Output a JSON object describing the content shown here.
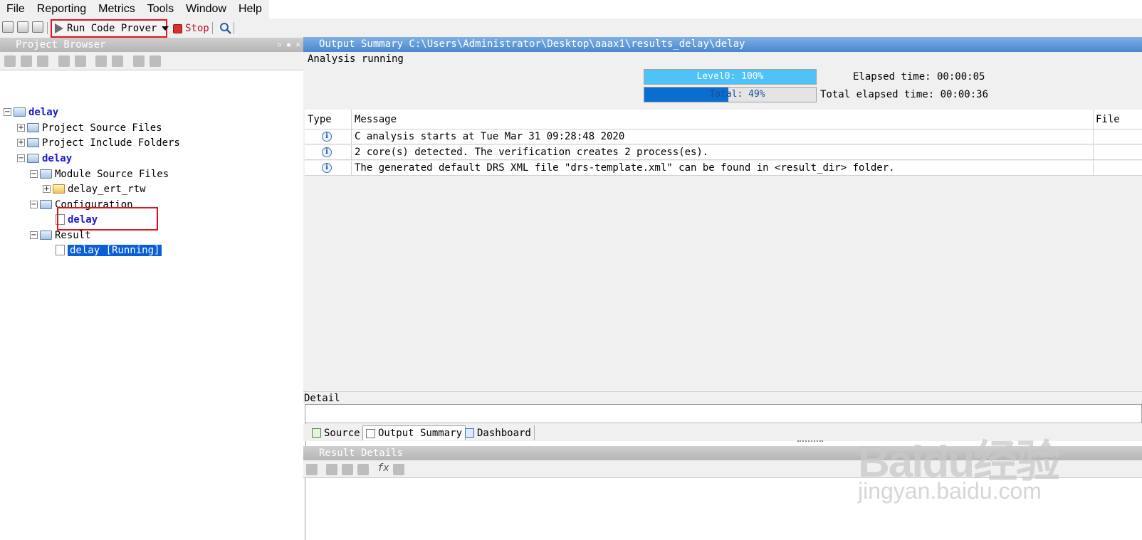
{
  "menu": [
    "File",
    "Reporting",
    "Metrics",
    "Tools",
    "Window",
    "Help"
  ],
  "toolbar": {
    "run_label": "Run Code Prover",
    "stop_label": "Stop"
  },
  "project_browser": {
    "title": "Project Browser",
    "tree": [
      {
        "label": "delay",
        "style": "bold-blue"
      },
      {
        "label": "Project Source Files"
      },
      {
        "label": "Project Include Folders"
      },
      {
        "label": "delay",
        "style": "bold-blue"
      },
      {
        "label": "Module Source Files"
      },
      {
        "label": "delay_ert_rtw"
      },
      {
        "label": "Configuration"
      },
      {
        "label": "delay",
        "style": "bold-blue"
      },
      {
        "label": "Result"
      },
      {
        "label": "delay [Running]",
        "style": "selected"
      }
    ]
  },
  "output_summary": {
    "title": "Output Summary C:\\Users\\Administrator\\Desktop\\aaax1\\results_delay\\delay",
    "status": "Analysis running",
    "level_bar": {
      "label": "Level0: 100%",
      "progress": 1.0
    },
    "total_bar": {
      "label": "Total: 49%",
      "progress": 0.49
    },
    "elapsed_label": "Elapsed time: 00:00:05",
    "total_elapsed_label": "Total elapsed time: 00:00:36",
    "columns": {
      "type": "Type",
      "message": "Message",
      "file": "File"
    },
    "messages": [
      "C analysis starts at Tue Mar 31 09:28:48 2020",
      "2 core(s) detected. The verification creates 2 process(es).",
      "The generated default DRS XML file \"drs-template.xml\" can be found in <result_dir> folder."
    ]
  },
  "detail": {
    "label": "Detail"
  },
  "tabs": [
    "Source",
    "Output Summary",
    "Dashboard"
  ],
  "result_details": {
    "title": "Result Details",
    "fx": "fx"
  },
  "watermark": {
    "logo": "Baidu经验",
    "url": "jingyan.baidu.com"
  },
  "colors": {
    "level_fill": "#4fc3f7",
    "total_fill": "#0a6ed1",
    "selection": "#0a5fd6",
    "highlight_border": "#e0141e",
    "bold_blue": "#1a18d6"
  }
}
